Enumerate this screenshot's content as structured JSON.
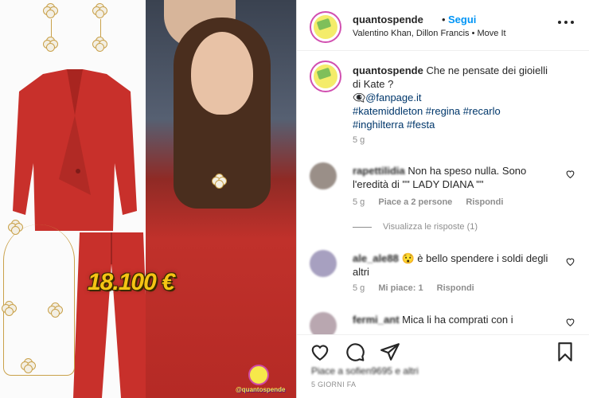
{
  "media": {
    "price_overlay": "18.100 €",
    "watermark": "@quantospende"
  },
  "header": {
    "username": "quantospende",
    "separator": "•",
    "follow_label": "Segui",
    "subtitle": "Valentino Khan, Dillon Francis • Move It"
  },
  "caption": {
    "username": "quantospende",
    "text": "Che ne pensate dei gioielli di Kate ?",
    "source_prefix": "👁️‍🗨️",
    "source": "@fanpage.it",
    "hashtags_line1": "#katemiddleton #regina #recarlo",
    "hashtags_line2": "#inghilterra #festa",
    "time": "5 g"
  },
  "comments": [
    {
      "username": "rapettilidia",
      "text": "Non ha speso nulla. Sono l'eredità di \"\" LADY DIANA \"\"",
      "time": "5 g",
      "likes": "Piace a 2 persone",
      "reply": "Rispondi",
      "avatar_color": "#9a8f88"
    },
    {
      "username": "ale_ale88",
      "emoji": "😯",
      "text": "è bello spendere i soldi degli altri",
      "time": "5 g",
      "likes": "Mi piace: 1",
      "reply": "Rispondi",
      "avatar_color": "#a7a0c0"
    },
    {
      "username": "fermi_ant",
      "text": "Mica li ha comprati con i",
      "avatar_color": "#b9a7b0"
    }
  ],
  "view_replies": "Visualizza le risposte (1)",
  "footer": {
    "likes_text": "Piace a sofien9695 e altri",
    "date": "5 GIORNI FA"
  },
  "colors": {
    "follow_blue": "#0095f6",
    "hashtag": "#00376b",
    "price_yellow": "#f5c414",
    "suit_red": "#c8302b"
  },
  "icons": [
    "more-options-icon",
    "heart-icon",
    "comment-icon",
    "share-icon",
    "bookmark-icon"
  ]
}
